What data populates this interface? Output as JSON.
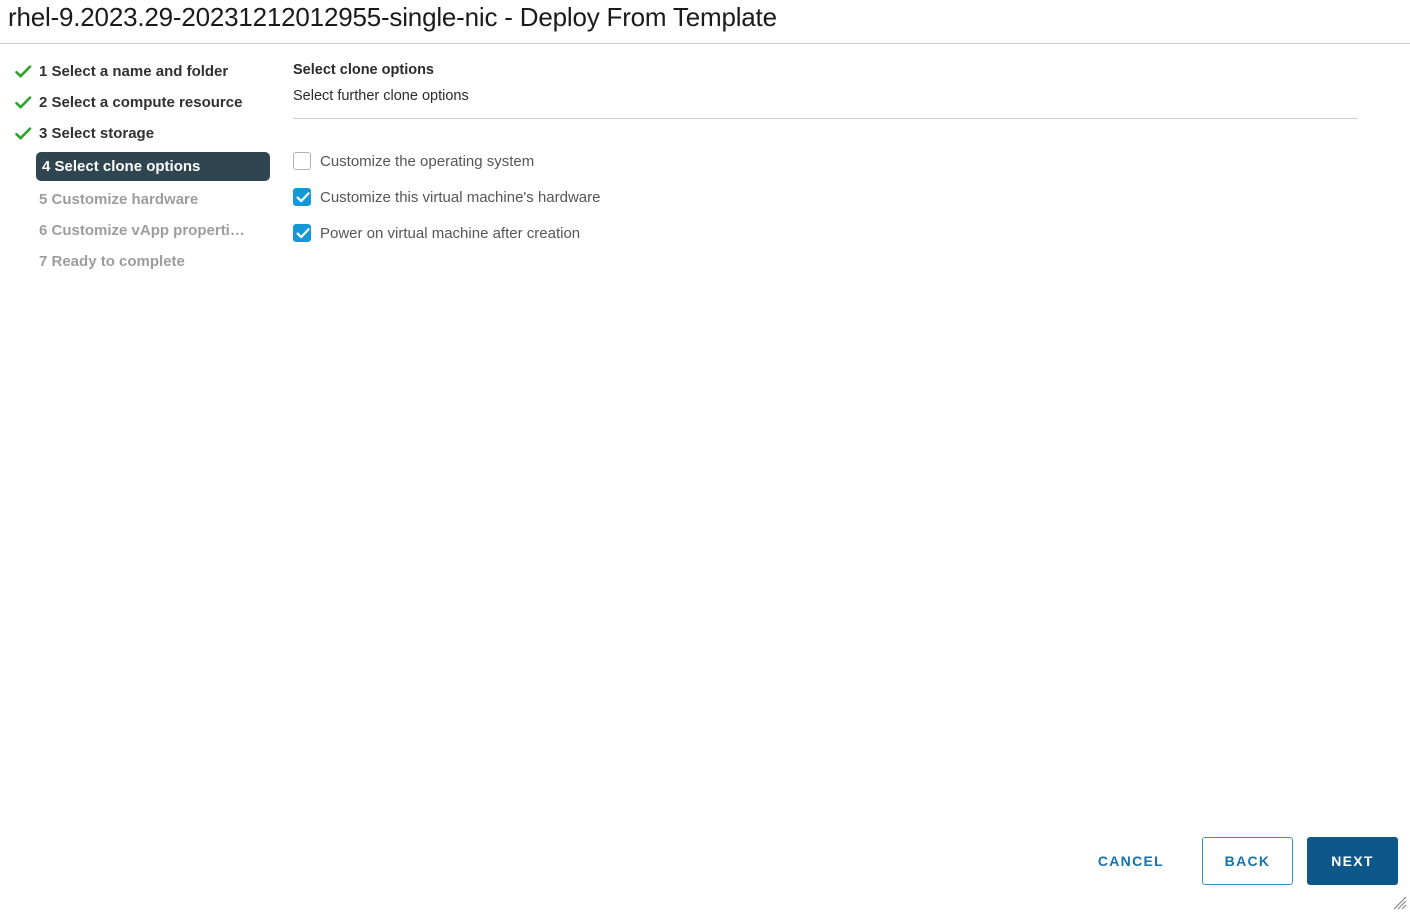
{
  "window": {
    "title": "rhel-9.2023.29-20231212012955-single-nic - Deploy From Template"
  },
  "colors": {
    "accent_blue": "#1499d8",
    "primary_button": "#0d5889",
    "link_blue": "#1373ad",
    "active_step_bg": "#2f454f",
    "check_green": "#2ba52b",
    "divider": "#cdcdcd"
  },
  "sidebar": {
    "steps": [
      {
        "number": "1",
        "label": "1 Select a name and folder",
        "state": "completed"
      },
      {
        "number": "2",
        "label": "2 Select a compute resource",
        "state": "completed"
      },
      {
        "number": "3",
        "label": "3 Select storage",
        "state": "completed"
      },
      {
        "number": "4",
        "label": "4 Select clone options",
        "state": "active"
      },
      {
        "number": "5",
        "label": "5 Customize hardware",
        "state": "pending"
      },
      {
        "number": "6",
        "label": "6 Customize vApp properti…",
        "state": "pending"
      },
      {
        "number": "7",
        "label": "7 Ready to complete",
        "state": "pending"
      }
    ]
  },
  "content": {
    "title": "Select clone options",
    "subtitle": "Select further clone options",
    "options": [
      {
        "label": "Customize the operating system",
        "checked": false
      },
      {
        "label": "Customize this virtual machine's hardware",
        "checked": true
      },
      {
        "label": "Power on virtual machine after creation",
        "checked": true
      }
    ]
  },
  "footer": {
    "cancel_label": "Cancel",
    "back_label": "Back",
    "next_label": "Next"
  }
}
